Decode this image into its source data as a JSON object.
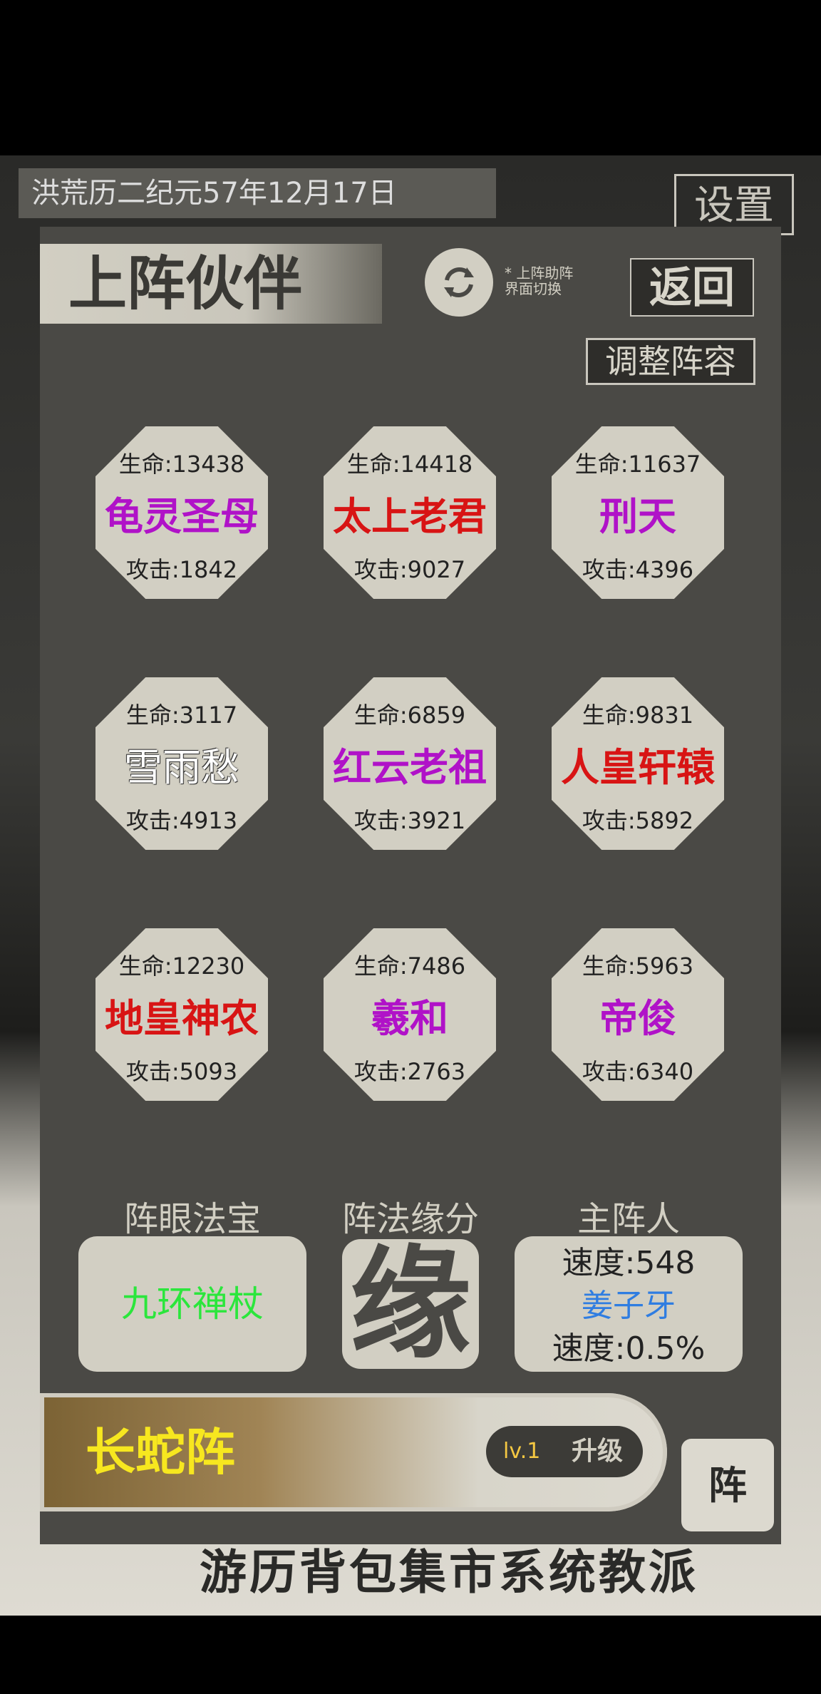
{
  "date": "洪荒历二纪元57年12月17日",
  "settings_label": "设置",
  "bottom_nav": "游历背包集市系统教派",
  "panel": {
    "title": "上阵伙伴",
    "switch_label": "* 上阵助阵 界面切换",
    "back_label": "返回",
    "adjust_label": "调整阵容"
  },
  "partners": [
    {
      "name": "龟灵圣母",
      "hp": "生命:13438",
      "atk": "攻击:1842",
      "color": "#b012c8"
    },
    {
      "name": "太上老君",
      "hp": "生命:14418",
      "atk": "攻击:9027",
      "color": "#d81414"
    },
    {
      "name": "刑天",
      "hp": "生命:11637",
      "atk": "攻击:4396",
      "color": "#b012c8"
    },
    {
      "name": "雪雨愁",
      "hp": "生命:3117",
      "atk": "攻击:4913",
      "color": "#ffffff"
    },
    {
      "name": "红云老祖",
      "hp": "生命:6859",
      "atk": "攻击:3921",
      "color": "#b012c8"
    },
    {
      "name": "人皇轩辕",
      "hp": "生命:9831",
      "atk": "攻击:5892",
      "color": "#d81414"
    },
    {
      "name": "地皇神农",
      "hp": "生命:12230",
      "atk": "攻击:5093",
      "color": "#d81414"
    },
    {
      "name": "羲和",
      "hp": "生命:7486",
      "atk": "攻击:2763",
      "color": "#b012c8"
    },
    {
      "name": "帝俊",
      "hp": "生命:5963",
      "atk": "攻击:6340",
      "color": "#b012c8"
    }
  ],
  "sections": {
    "treasure_label": "阵眼法宝",
    "fate_label": "阵法缘分",
    "leader_label": "主阵人"
  },
  "treasure": "九环禅杖",
  "fate_char": "缘",
  "leader": {
    "speed": "速度:548",
    "name": "姜子牙",
    "bonus": "速度:0.5%"
  },
  "formation": {
    "name": "长蛇阵",
    "level": "lv.1",
    "upgrade": "升级"
  },
  "zhen_label": "阵"
}
